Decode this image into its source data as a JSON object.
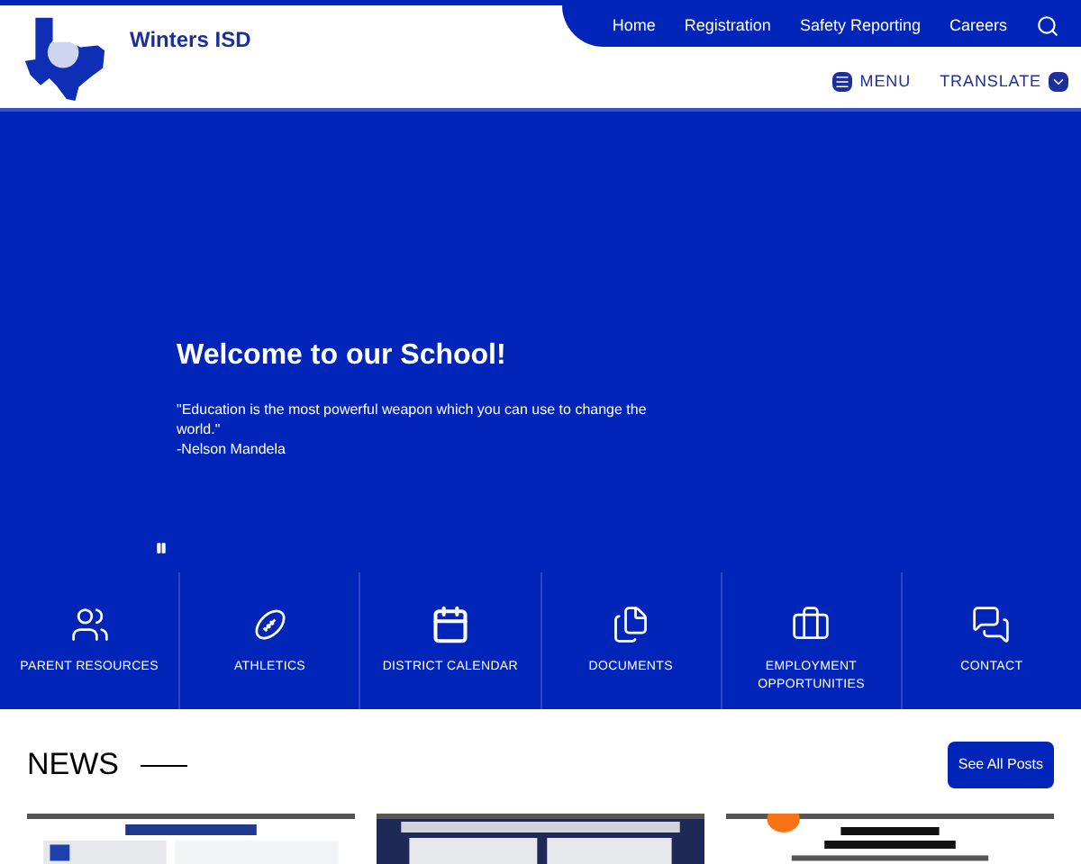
{
  "header": {
    "site_name": "Winters ISD",
    "top_nav": [
      {
        "label": "Home"
      },
      {
        "label": "Registration"
      },
      {
        "label": "Safety Reporting"
      },
      {
        "label": "Careers"
      }
    ],
    "menu": "MENU",
    "translate": "TRANSLATE"
  },
  "hero": {
    "title": "Welcome to our School!",
    "quote": "\"Education is the most powerful weapon which you can use to change the world.\"",
    "author": "-Nelson Mandela"
  },
  "quick_links": [
    {
      "label": "PARENT RESOURCES",
      "kind": "family"
    },
    {
      "label": "ATHLETICS",
      "kind": "football"
    },
    {
      "label": "DISTRICT CALENDAR",
      "kind": "calendar"
    },
    {
      "label": "DOCUMENTS",
      "kind": "documents"
    },
    {
      "label": "EMPLOYMENT OPPORTUNITIES",
      "kind": "briefcase"
    },
    {
      "label": "CONTACT",
      "kind": "chat"
    }
  ],
  "news": {
    "title": "NEWS",
    "button": "See All Posts"
  }
}
